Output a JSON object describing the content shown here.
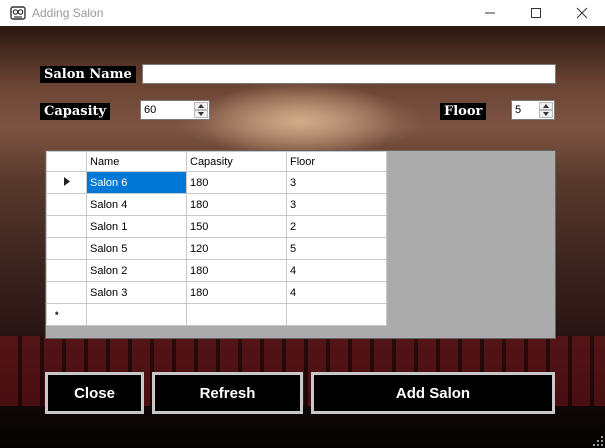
{
  "window": {
    "title": "Adding Salon"
  },
  "form": {
    "salon_name_label": "Salon Name",
    "salon_name_value": "",
    "capasity_label": "Capasity",
    "capasity_value": "60",
    "floor_label": "Floor",
    "floor_value": "5"
  },
  "grid": {
    "columns": [
      "Name",
      "Capasity",
      "Floor"
    ],
    "rows": [
      [
        "Salon 6",
        "180",
        "3"
      ],
      [
        "Salon 4",
        "180",
        "3"
      ],
      [
        "Salon 1",
        "150",
        "2"
      ],
      [
        "Salon 5",
        "120",
        "5"
      ],
      [
        "Salon 2",
        "180",
        "4"
      ],
      [
        "Salon 3",
        "180",
        "4"
      ]
    ],
    "new_row_marker": "*"
  },
  "buttons": {
    "close": "Close",
    "refresh": "Refresh",
    "add_salon": "Add Salon"
  },
  "colors": {
    "selection": "#0078d7",
    "button_border": "#c8c8c8",
    "grid_bg": "#ababab"
  },
  "icons": [
    "app-icon",
    "minimize-icon",
    "maximize-icon",
    "close-window-icon",
    "current-row-icon",
    "resize-grip-icon"
  ]
}
